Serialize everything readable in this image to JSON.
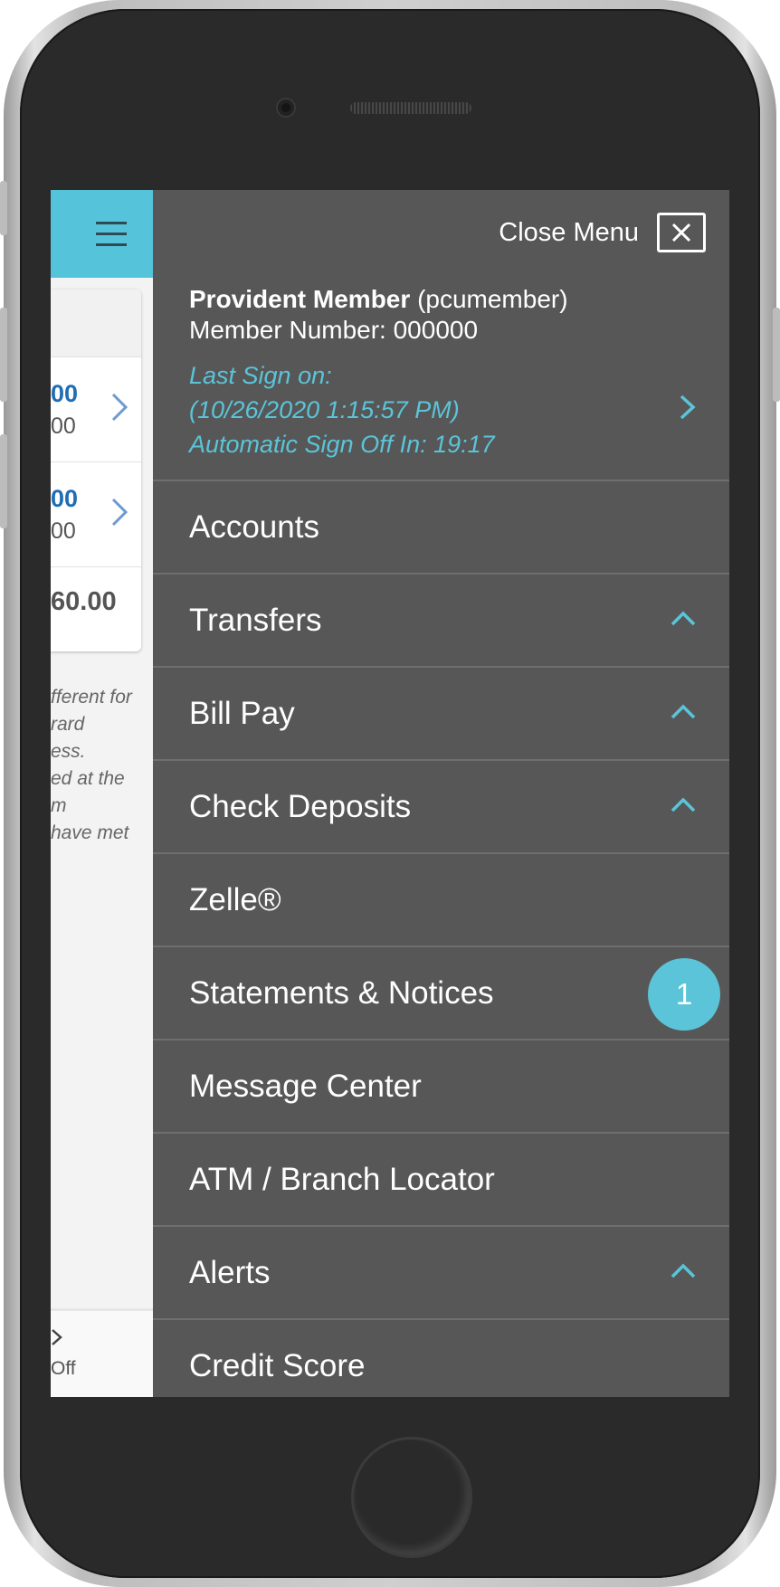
{
  "menu": {
    "close_label": "Close Menu",
    "member": {
      "name": "Provident Member",
      "username": "(pcumember)",
      "number_line": "Member Number: 000000"
    },
    "session": {
      "last_sign_on_label": "Last Sign on:",
      "last_sign_on_value": "(10/26/2020 1:15:57 PM)",
      "auto_sign_off": "Automatic Sign Off In: 19:17"
    },
    "items": [
      {
        "label": "Accounts"
      },
      {
        "label": "Transfers",
        "expandable": true
      },
      {
        "label": "Bill Pay",
        "expandable": true
      },
      {
        "label": "Check Deposits",
        "expandable": true
      },
      {
        "label": "Zelle®"
      },
      {
        "label": "Statements & Notices",
        "badge": "1"
      },
      {
        "label": "Message Center"
      },
      {
        "label": "ATM / Branch Locator"
      },
      {
        "label": "Alerts",
        "expandable": true
      },
      {
        "label": "Credit Score"
      }
    ]
  },
  "background": {
    "rows": [
      {
        "amount": "00",
        "sub": "00"
      },
      {
        "amount": "00",
        "sub": "00"
      }
    ],
    "total": "60.00",
    "note_lines": [
      "fferent for",
      "rard",
      "ess.",
      "ed at the",
      "m",
      "have met"
    ],
    "footer_label": "Off"
  },
  "colors": {
    "accent": "#5bc4d8",
    "menu_bg": "#575757",
    "header_bg": "#55c3d9",
    "link_blue": "#1e6eb5"
  },
  "icons": {
    "hamburger": "hamburger-icon",
    "close": "close-icon",
    "chevron_right": "chevron-right-icon",
    "chevron_up": "chevron-up-icon",
    "sign_off": "sign-off-icon"
  }
}
